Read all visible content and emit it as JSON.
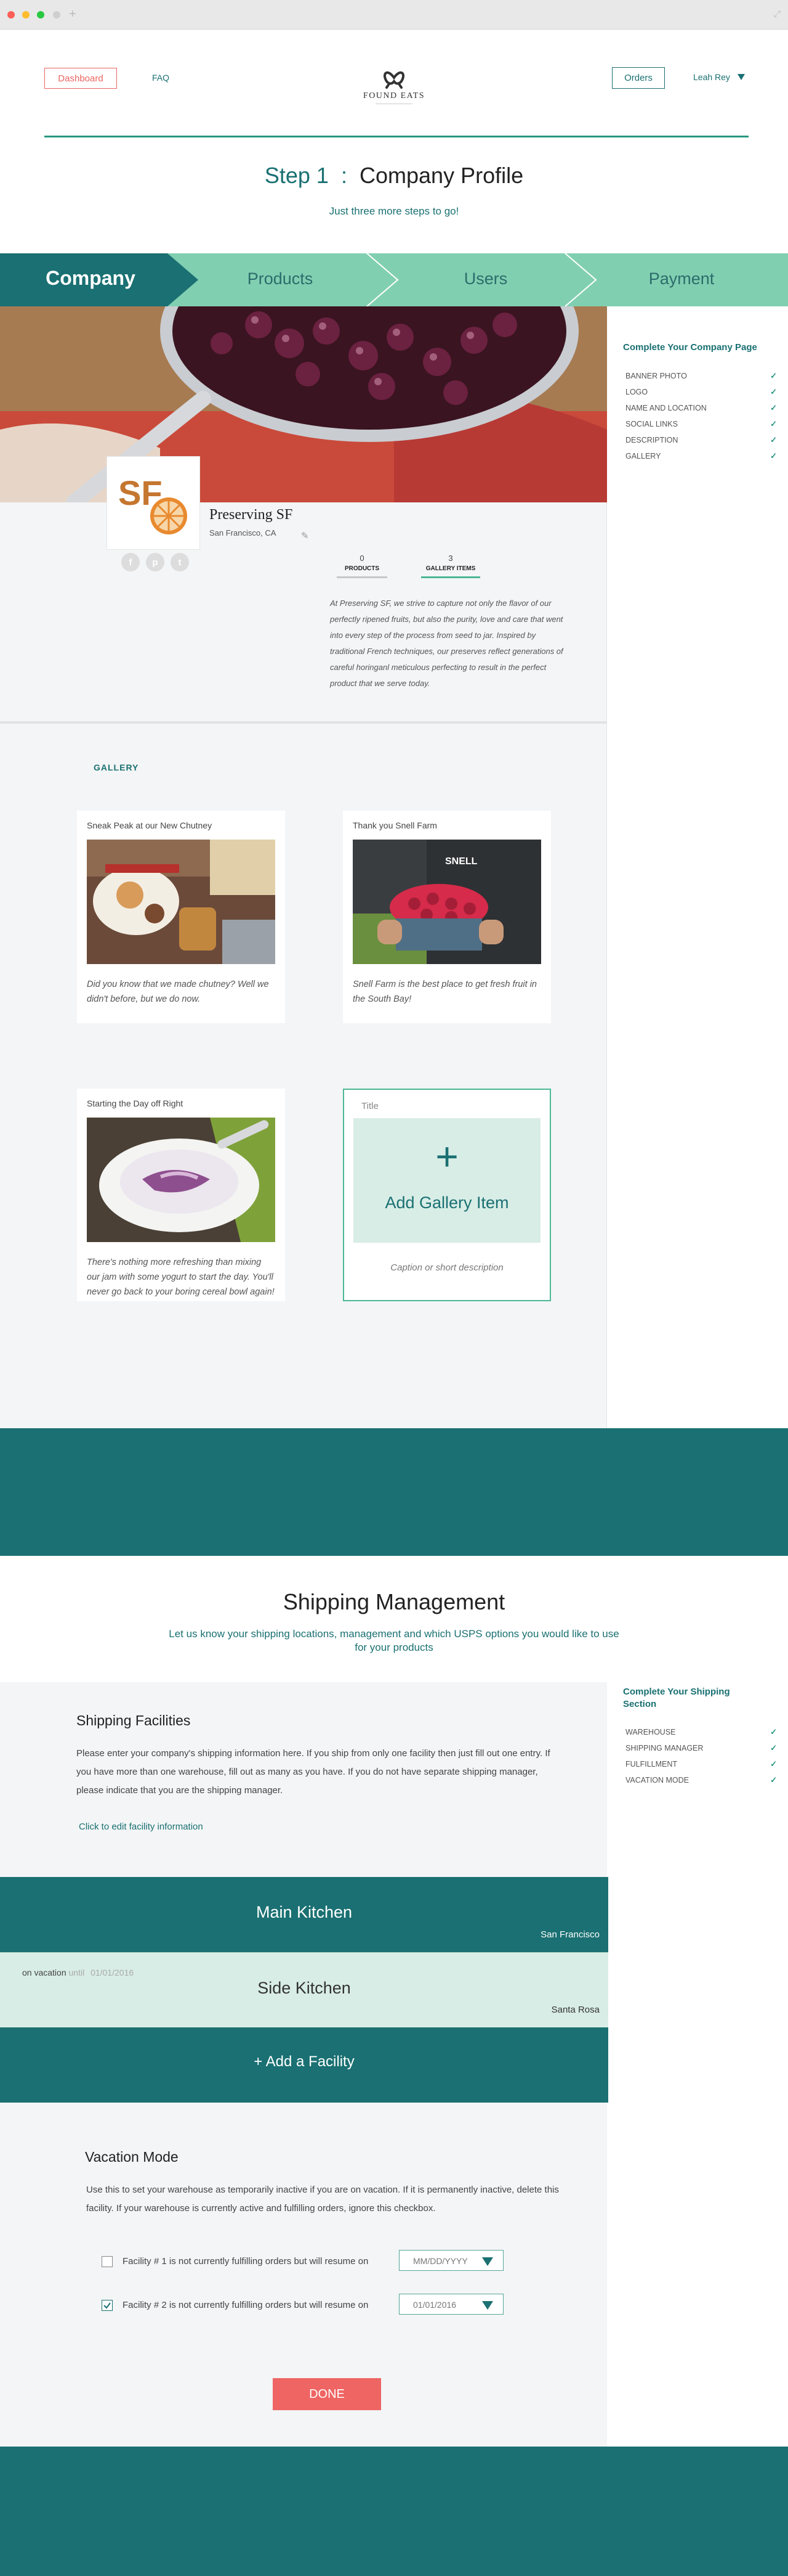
{
  "header": {
    "dashboard_label": "Dashboard",
    "faq_label": "FAQ",
    "logo_text": "FOUND EATS",
    "orders_label": "Orders",
    "user_name": "Leah Rey"
  },
  "step": {
    "number": "Step 1",
    "separator": ":",
    "title": "Company Profile",
    "subtitle": "Just three more steps to go!"
  },
  "progress_steps": [
    {
      "label": "Company",
      "active": true
    },
    {
      "label": "Products",
      "active": false
    },
    {
      "label": "Users",
      "active": false
    },
    {
      "label": "Payment",
      "active": false
    }
  ],
  "company_checklist": {
    "title": "Complete Your Company Page",
    "items": [
      {
        "label": "BANNER PHOTO",
        "done": true
      },
      {
        "label": "LOGO",
        "done": true
      },
      {
        "label": "NAME AND LOCATION",
        "done": true
      },
      {
        "label": "SOCIAL LINKS",
        "done": true
      },
      {
        "label": "DESCRIPTION",
        "done": true
      },
      {
        "label": "GALLERY",
        "done": true
      }
    ]
  },
  "profile": {
    "logo_text": "SF",
    "name": "Preserving SF",
    "location": "San Francisco, CA",
    "social": [
      "f",
      "p",
      "t"
    ],
    "stats": [
      {
        "value": "0",
        "label": "PRODUCTS"
      },
      {
        "value": "3",
        "label": "GALLERY ITEMS"
      }
    ],
    "description": "At Preserving SF, we strive to capture not only the flavor of our perfectly ripened fruits, but also the purity, love and care that went into every step of the process from seed to jar. Inspired by traditional French techniques, our preserves reflect generations of careful horinganl meticulous perfecting to result in the perfect product that we serve today."
  },
  "gallery": {
    "heading": "GALLERY",
    "items": [
      {
        "title": "Sneak Peak at our New Chutney",
        "caption": "Did you know that we made chutney? Well we didn't before, but we do now."
      },
      {
        "title": "Thank you Snell Farm",
        "caption": "Snell Farm is the best place to get fresh fruit in the South Bay!"
      },
      {
        "title": "Starting the Day off Right",
        "caption": "There's nothing more refreshing than mixing our jam with some yogurt to start the day. You'll never go back to your boring cereal bowl again!"
      }
    ],
    "add_card": {
      "title_placeholder": "Title",
      "plus": "+",
      "label": "Add Gallery Item",
      "caption_placeholder": "Caption or short description"
    }
  },
  "shipping": {
    "title": "Shipping Management",
    "subtitle": "Let us know your shipping locations, management and which USPS options you would like to use for your products",
    "checklist": {
      "title": "Complete Your Shipping Section",
      "items": [
        {
          "label": "WAREHOUSE",
          "done": true
        },
        {
          "label": "SHIPPING MANAGER",
          "done": true
        },
        {
          "label": "FULFILLMENT",
          "done": true
        },
        {
          "label": "VACATION MODE",
          "done": true
        }
      ]
    },
    "facilities_heading": "Shipping Facilities",
    "facilities_text": "Please enter your company's shipping information here. If you ship from only one facility then just fill out one entry. If you have more than one warehouse, fill out as many as you have. If you do not have separate shipping manager, please indicate that you are the shipping manager.",
    "edit_link": "Click to edit facility information",
    "facilities": [
      {
        "name": "Main Kitchen",
        "city": "San Francisco",
        "note": "",
        "note_until": "",
        "note_date": ""
      },
      {
        "name": "Side Kitchen",
        "city": "Santa Rosa",
        "note": "on vacation",
        "note_until": "until",
        "note_date": "01/01/2016"
      }
    ],
    "add_facility": "+ Add a Facility",
    "vacation": {
      "heading": "Vacation Mode",
      "text": "Use this to set your warehouse as temporarily inactive if you are on vacation. If it is permanently inactive, delete this facility. If your warehouse is currently active and fulfilling orders, ignore this checkbox.",
      "rows": [
        {
          "label": "Facility # 1 is not currently fulfilling orders but will resume on",
          "date": "MM/DD/YYYY",
          "checked": false
        },
        {
          "label": "Facility # 2 is not currently fulfilling orders but will resume on",
          "date": "01/01/2016",
          "checked": true
        }
      ]
    },
    "done_label": "DONE"
  },
  "colors": {
    "teal_dark": "#1a7072",
    "teal_light": "#81cfb1",
    "accent_red": "#ee6563",
    "mint": "#d8ede6"
  }
}
